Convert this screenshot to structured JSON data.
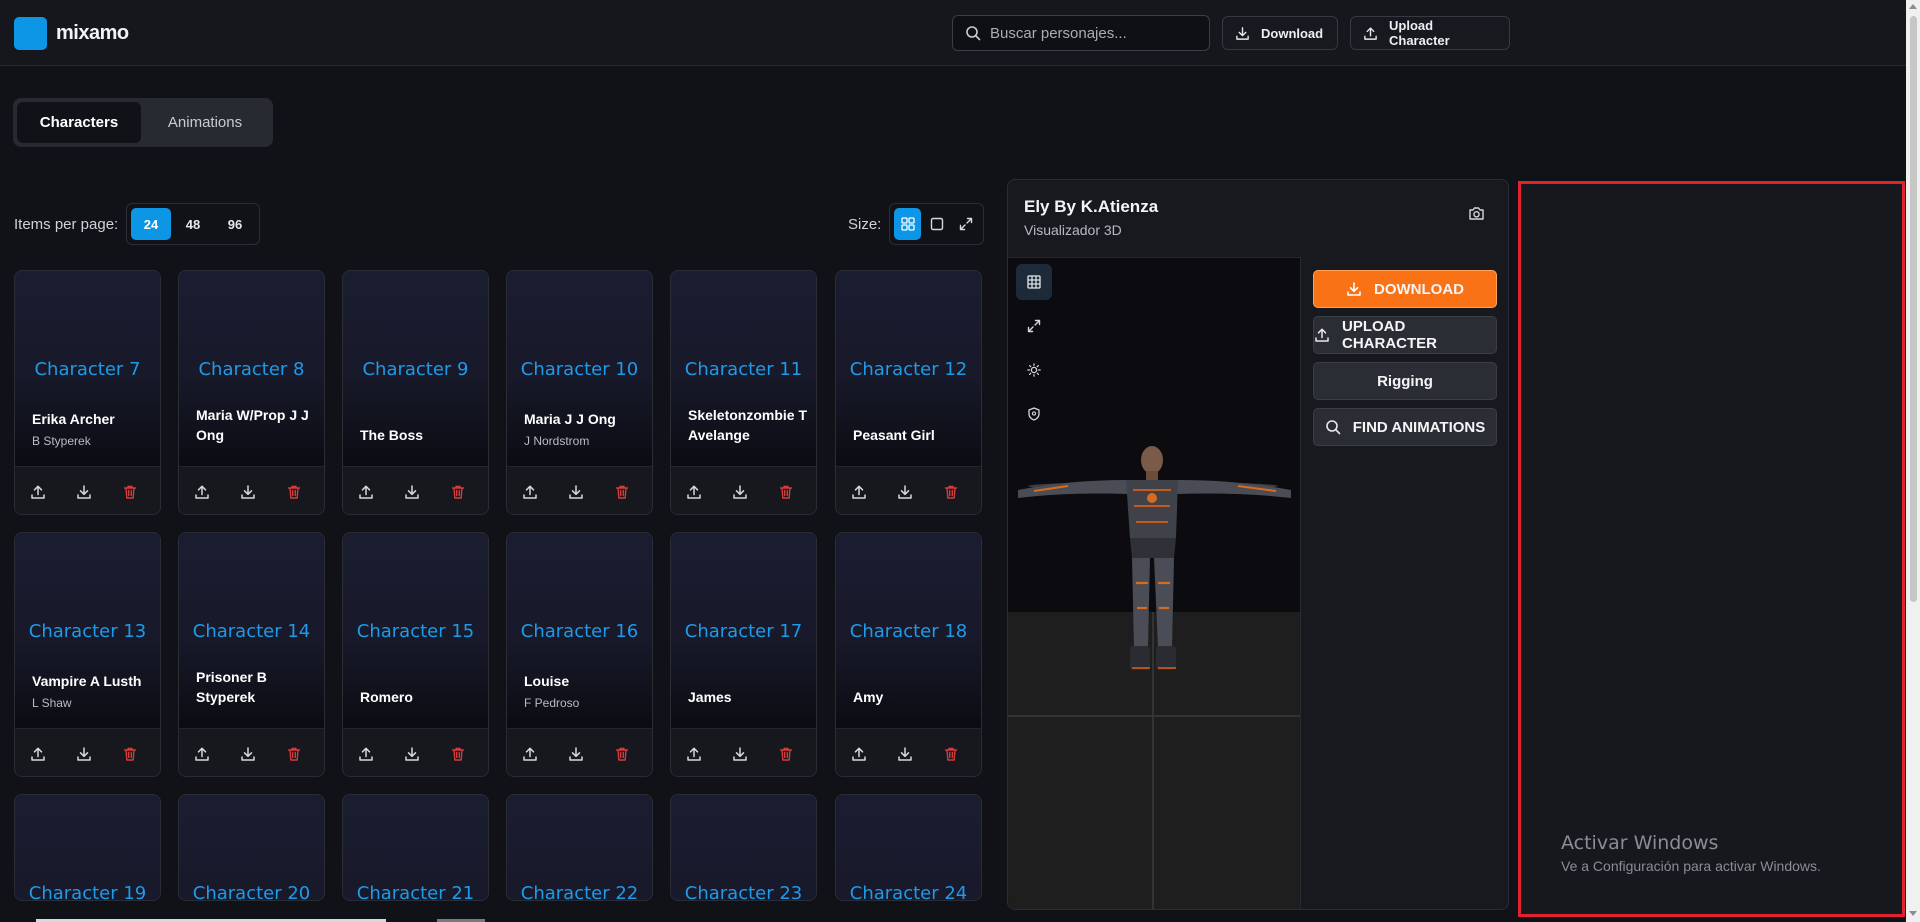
{
  "app": {
    "name": "mixamo",
    "brand_color": "#0e96e6"
  },
  "header": {
    "search_placeholder": "Buscar personajes...",
    "download_label": "Download",
    "upload_label": "Upload Character"
  },
  "tabs": [
    {
      "label": "Characters",
      "active": true
    },
    {
      "label": "Animations",
      "active": false
    }
  ],
  "pagination": {
    "label": "Items per page:",
    "options": [
      "24",
      "48",
      "96"
    ],
    "selected": "24"
  },
  "size_control": {
    "label": "Size:",
    "selected": "grid-icon"
  },
  "characters": [
    {
      "title": "Character 7",
      "name": "Erika Archer",
      "author": "B Styperek"
    },
    {
      "title": "Character 8",
      "name": "Maria W/Prop J J Ong",
      "author": ""
    },
    {
      "title": "Character 9",
      "name": "The Boss",
      "author": ""
    },
    {
      "title": "Character 10",
      "name": "Maria J J Ong",
      "author": "J Nordstrom"
    },
    {
      "title": "Character 11",
      "name": "Skeletonzombie T Avelange",
      "author": ""
    },
    {
      "title": "Character 12",
      "name": "Peasant Girl",
      "author": ""
    },
    {
      "title": "Character 13",
      "name": "Vampire A Lusth",
      "author": "L Shaw"
    },
    {
      "title": "Character 14",
      "name": "Prisoner B Styperek",
      "author": ""
    },
    {
      "title": "Character 15",
      "name": "Romero",
      "author": ""
    },
    {
      "title": "Character 16",
      "name": "Louise",
      "author": "F Pedroso"
    },
    {
      "title": "Character 17",
      "name": "James",
      "author": ""
    },
    {
      "title": "Character 18",
      "name": "Amy",
      "author": ""
    },
    {
      "title": "Character 19"
    },
    {
      "title": "Character 20"
    },
    {
      "title": "Character 21"
    },
    {
      "title": "Character 22"
    },
    {
      "title": "Character 23"
    },
    {
      "title": "Character 24"
    }
  ],
  "viewer": {
    "title": "Ely By K.Atienza",
    "subtitle": "Visualizador 3D",
    "download_label": "DOWNLOAD",
    "upload_label": "UPLOAD CHARACTER",
    "rigging_label": "Rigging",
    "find_label": "FIND ANIMATIONS",
    "accent_color": "#f97316"
  },
  "windows_notice": {
    "title": "Activar Windows",
    "subtitle": "Ve a Configuración para activar Windows."
  }
}
